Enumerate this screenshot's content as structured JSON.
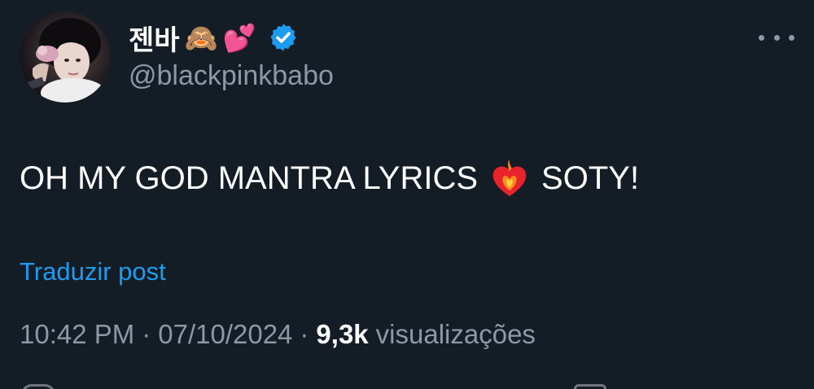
{
  "author": {
    "display_name": "젠바",
    "emojis": [
      "🙈",
      "💕"
    ],
    "handle": "@blackpinkbabo",
    "verified": true
  },
  "tweet": {
    "text_before": "OH MY GOD MANTRA LYRICS",
    "emoji": "❤️‍🔥",
    "text_after": "SOTY!"
  },
  "translate_label": "Traduzir post",
  "meta": {
    "time": "10:42 PM",
    "separator": "·",
    "date": "07/10/2024",
    "views_count": "9,3k",
    "views_label": "visualizações"
  },
  "icons": {
    "more": "more-horizontal-icon",
    "verified": "verified-badge-icon",
    "heart_fire": "heart-on-fire-icon"
  },
  "colors": {
    "background": "#141d26",
    "text": "#ffffff",
    "secondary_text": "#8b98a5",
    "link": "#1d9bf0",
    "verified": "#1d9bf0"
  }
}
